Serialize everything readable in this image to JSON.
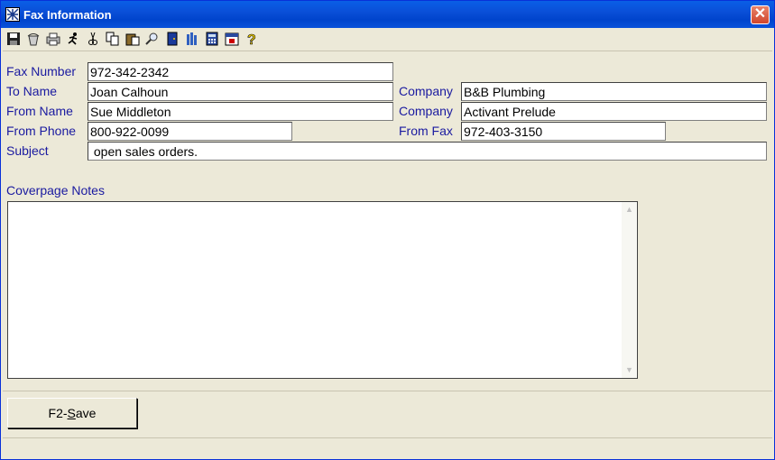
{
  "window": {
    "title": "Fax Information"
  },
  "toolbar": {
    "buttons": [
      "save-icon",
      "clear-icon",
      "print-icon",
      "run-icon",
      "cut-icon",
      "copy-icon",
      "paste-icon",
      "find-icon",
      "exit-door-icon",
      "tools-icon",
      "calculator-icon",
      "calendar-icon",
      "help-icon"
    ]
  },
  "form": {
    "fax_number_label": "Fax Number",
    "fax_number": "972-342-2342",
    "to_name_label": "To Name",
    "to_name": "Joan Calhoun",
    "to_company_label": "Company",
    "to_company": "B&B Plumbing",
    "from_name_label": "From Name",
    "from_name": "Sue Middleton",
    "from_company_label": "Company",
    "from_company": "Activant Prelude",
    "from_phone_label": "From Phone",
    "from_phone": "800-922-0099",
    "from_fax_label": "From Fax",
    "from_fax": "972-403-3150",
    "subject_label": "Subject",
    "subject": " open sales orders.",
    "notes_label": "Coverpage Notes",
    "notes": ""
  },
  "actions": {
    "save_prefix": "F2-",
    "save_underlined": "S",
    "save_suffix": "ave"
  }
}
